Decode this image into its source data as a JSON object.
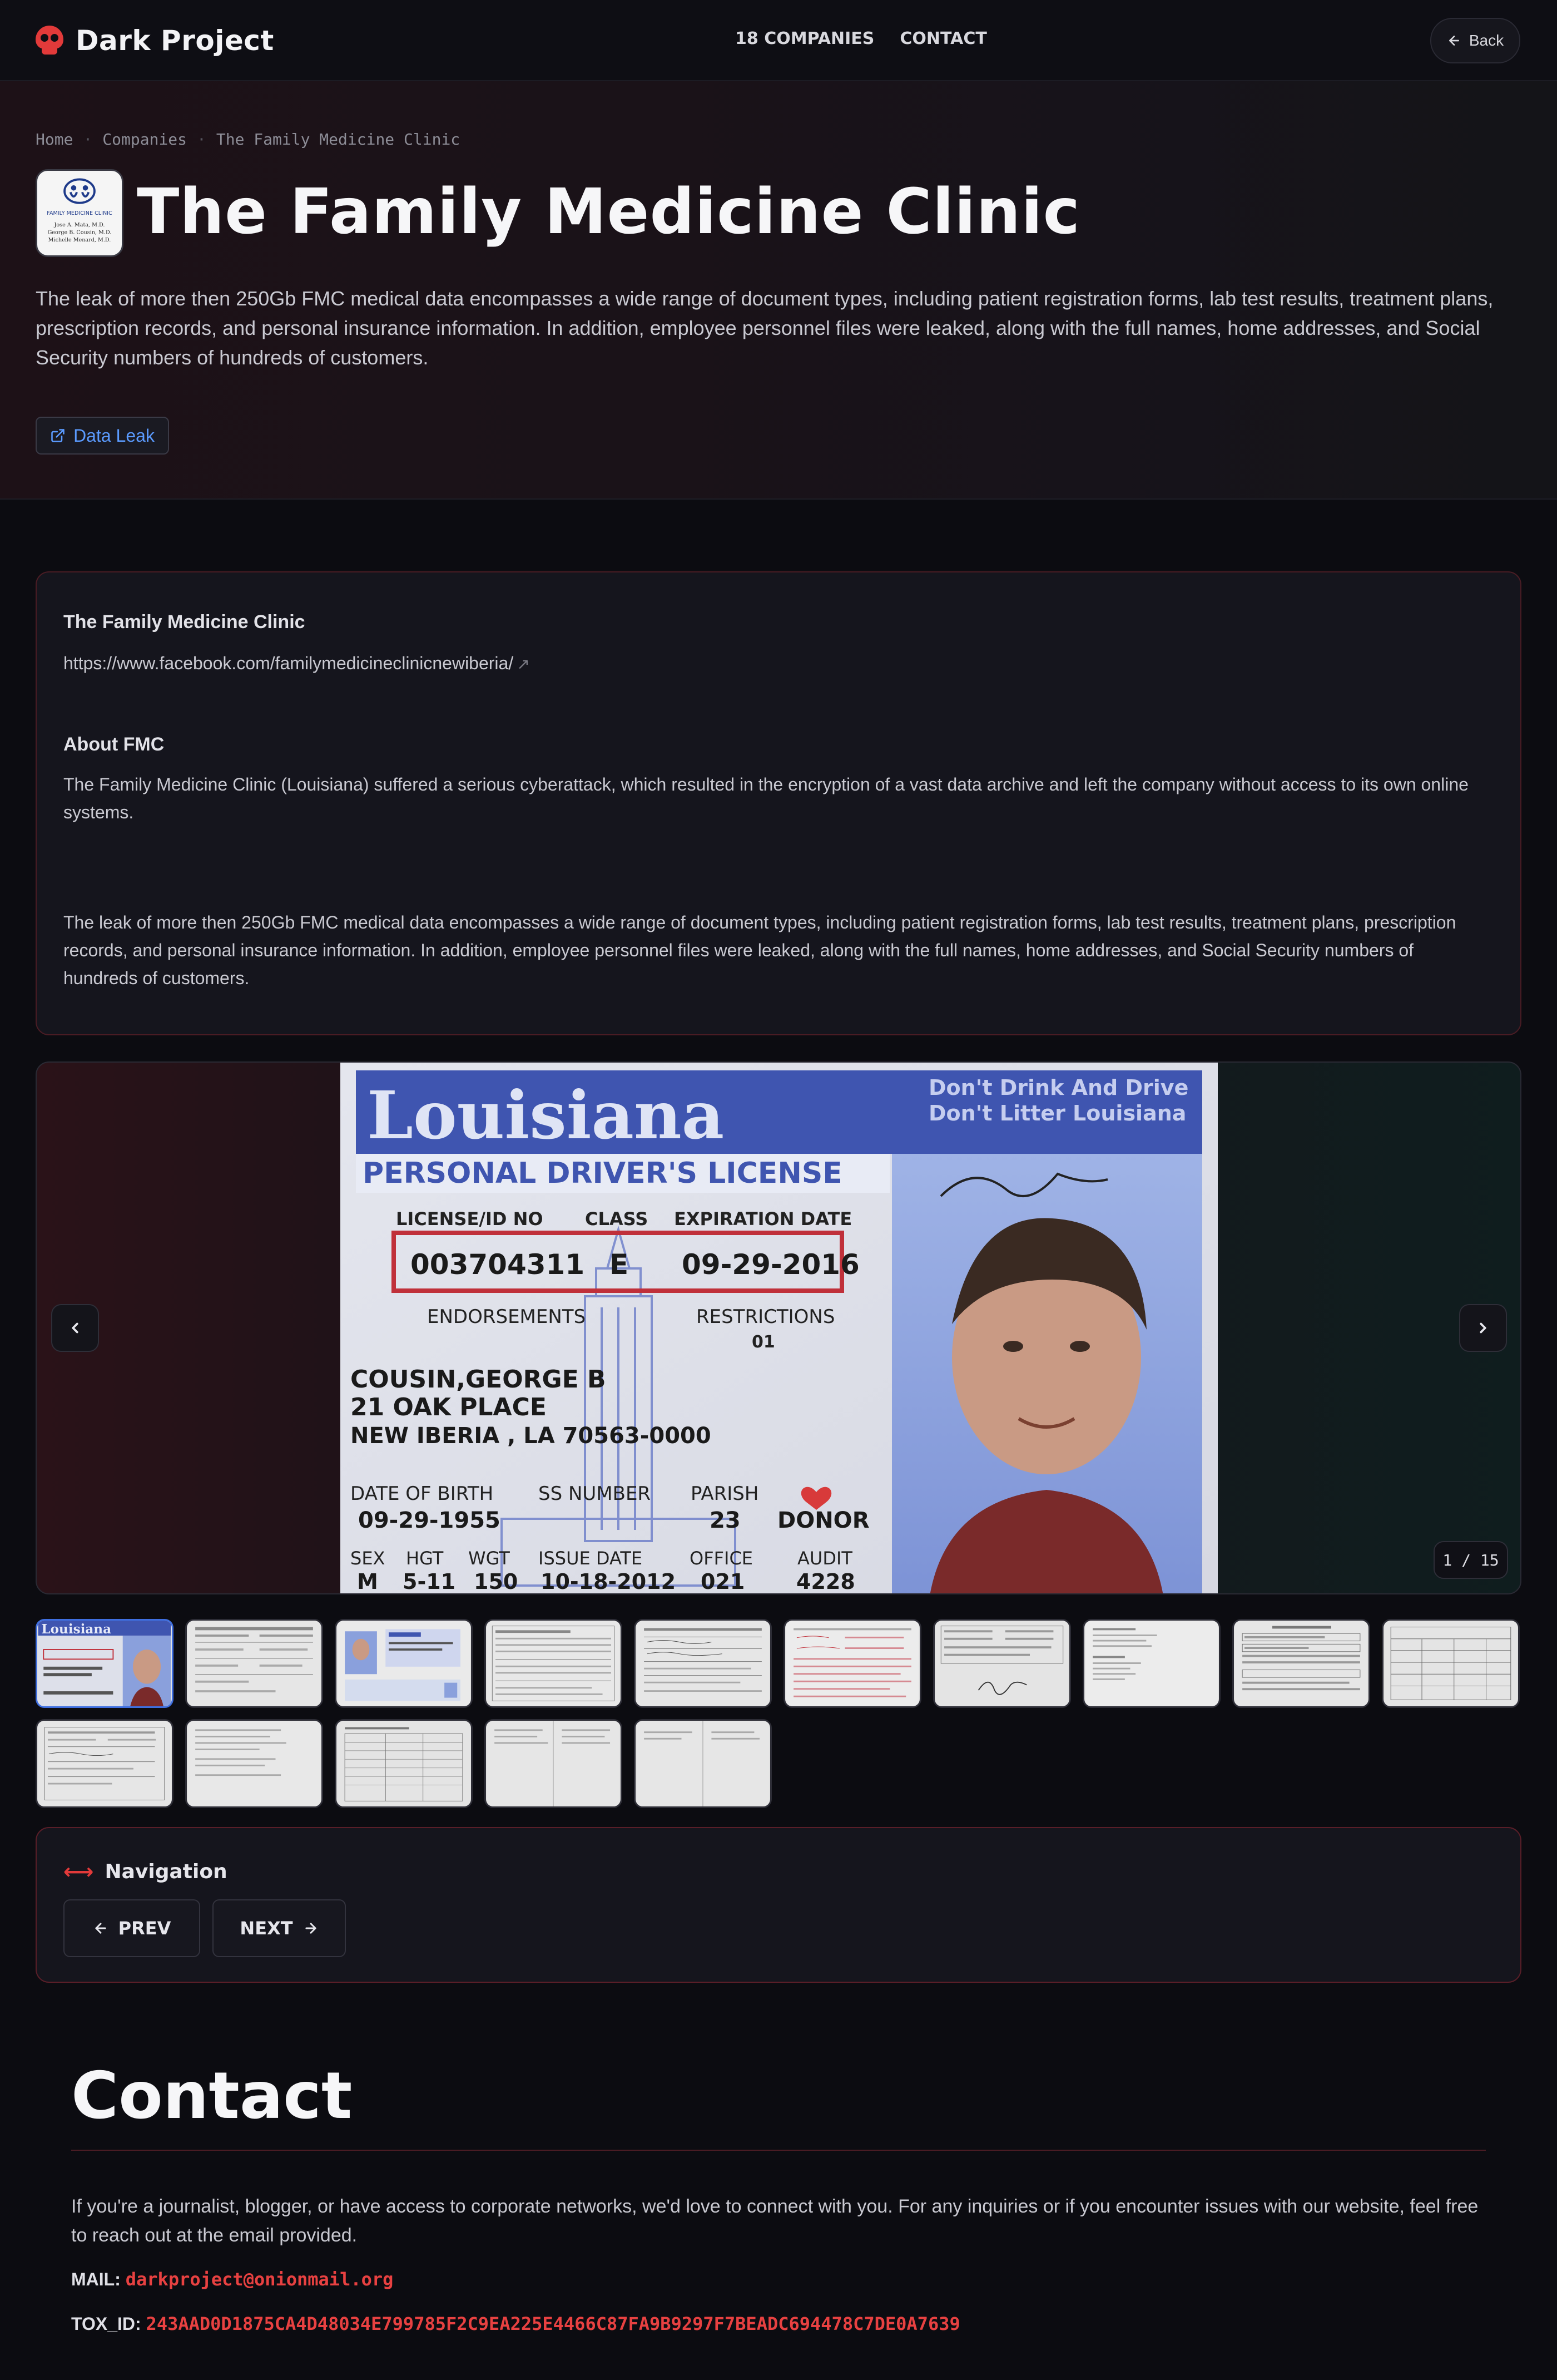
{
  "nav": {
    "brand": "Dark Project",
    "links": [
      "18 COMPANIES",
      "CONTACT"
    ],
    "back": "Back"
  },
  "hero": {
    "breadcrumb": [
      "Home",
      "Companies",
      "The Family Medicine Clinic"
    ],
    "title": "The Family Medicine Clinic",
    "logo_text": [
      "FAMILY MEDICINE CLINIC",
      "Jose A. Mata, M.D.",
      "George B. Cousin, M.D.",
      "Michelle Menard, M.D."
    ],
    "description": "The leak of more then 250Gb FMC medical data encompasses a wide range of document types, including patient registration forms, lab test results, treatment plans, prescription records, and personal insurance information. In addition, employee personnel files were leaked, along with the full names, home addresses, and Social Security numbers of hundreds of customers.",
    "tag": "Data Leak"
  },
  "info": {
    "company_heading": "The Family Medicine Clinic",
    "company_link": "https://www.facebook.com/familymedicineclinicnewiberia/",
    "about_heading": "About FMC",
    "about_text": "The Family Medicine Clinic (Louisiana) suffered a serious cyberattack, which resulted in the encryption of a vast data archive and left the company without access to its own online systems.",
    "leak_text": "The leak of more then 250Gb FMC medical data encompasses a wide range of document types, including patient registration forms, lab test results, treatment plans, prescription records, and personal insurance information. In addition, employee personnel files were leaked, along with the full names, home addresses, and Social Security numbers of hundreds of customers."
  },
  "gallery": {
    "counter": "1 / 15",
    "license": {
      "state": "Louisiana",
      "slogan1": "Don't Drink And Drive",
      "slogan2": "Don't Litter Louisiana",
      "type": "PERSONAL DRIVER'S LICENSE",
      "lbl_license": "LICENSE/ID NO",
      "lbl_class": "CLASS",
      "lbl_exp": "EXPIRATION DATE",
      "license_no": "003704311",
      "class": "E",
      "exp": "09-29-2016",
      "lbl_endorse": "ENDORSEMENTS",
      "lbl_restrict": "RESTRICTIONS",
      "restrict": "01",
      "name": "COUSIN,GEORGE B",
      "addr1": "21 OAK PLACE",
      "addr2": "NEW IBERIA , LA  70563-0000",
      "lbl_dob": "DATE OF BIRTH",
      "lbl_ss": "SS NUMBER",
      "lbl_parish": "PARISH",
      "dob": "09-29-1955",
      "parish": "23",
      "donor": "DONOR",
      "lbl_sex": "SEX",
      "lbl_hgt": "HGT",
      "lbl_wgt": "WGT",
      "lbl_issue": "ISSUE DATE",
      "lbl_office": "OFFICE",
      "lbl_audit": "AUDIT",
      "sex": "M",
      "hgt": "5-11",
      "wgt": "150",
      "issue": "10-18-2012",
      "office": "021",
      "audit": "4228"
    },
    "thumbnails": 15
  },
  "navigation": {
    "title": "Navigation",
    "prev": "PREV",
    "next": "NEXT"
  },
  "contact": {
    "title": "Contact",
    "text": "If you're a journalist, blogger, or have access to corporate networks, we'd love to connect with you. For any inquiries or if you encounter issues with our website, feel free to reach out at the email provided.",
    "mail_label": "MAIL:",
    "mail": "darkproject@onionmail.org",
    "tox_label": "TOX_ID:",
    "tox": "243AAD0D1875CA4D48034E799785F2C9EA225E4466C87FA9B9297F7BEADC694478C7DE0A7639"
  },
  "colors": {
    "accent": "#e23a3a",
    "link": "#5b9bff",
    "background": "#0c0c11"
  }
}
